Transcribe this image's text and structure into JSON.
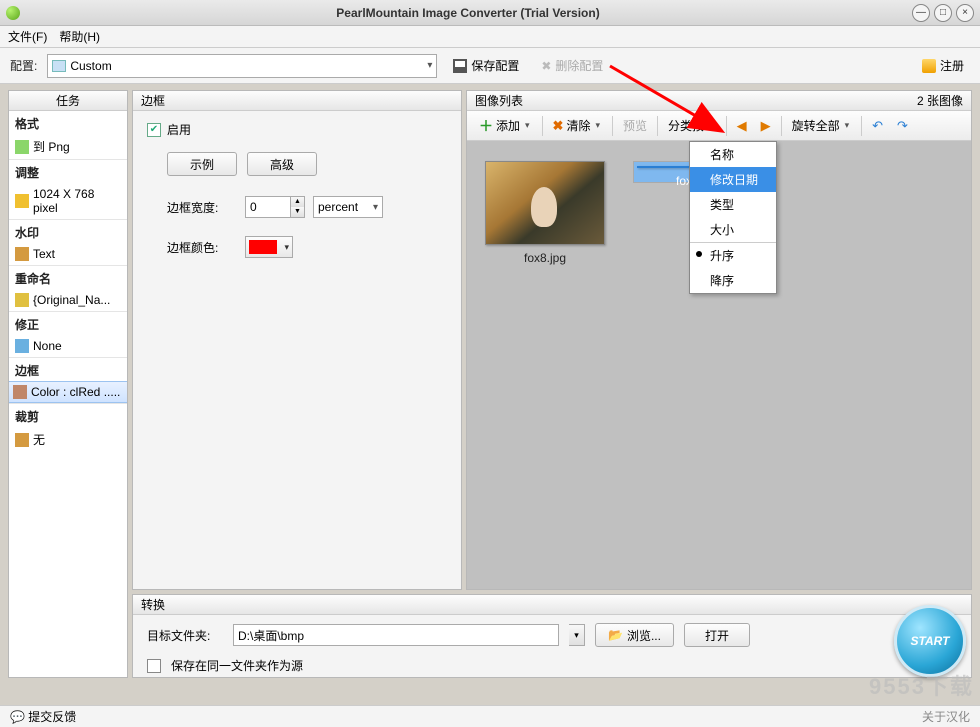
{
  "title": "PearlMountain Image Converter (Trial Version)",
  "menu": {
    "file": "文件(F)",
    "help": "帮助(H)"
  },
  "config": {
    "label": "配置:",
    "selected": "Custom",
    "save": "保存配置",
    "delete": "删除配置",
    "register": "注册"
  },
  "tasks": {
    "header": "任务",
    "groups": [
      {
        "label": "格式",
        "item": "到 Png"
      },
      {
        "label": "调整",
        "item": "1024 X 768 pixel"
      },
      {
        "label": "水印",
        "item": "Text"
      },
      {
        "label": "重命名",
        "item": "{Original_Na..."
      },
      {
        "label": "修正",
        "item": "None"
      },
      {
        "label": "边框",
        "item": "Color : clRed ....."
      },
      {
        "label": "裁剪",
        "item": "无"
      }
    ]
  },
  "border": {
    "title": "边框",
    "enable": "启用",
    "example": "示例",
    "advanced": "高级",
    "width_label": "边框宽度:",
    "width_value": "0",
    "width_unit": "percent",
    "color_label": "边框颜色:",
    "color_hex": "#ff0000"
  },
  "imagelist": {
    "title": "图像列表",
    "count": "2 张图像",
    "toolbar": {
      "add": "添加",
      "clear": "清除",
      "preview": "预览",
      "sort": "分类按",
      "rotate_all": "旋转全部"
    },
    "sort_menu": {
      "name": "名称",
      "modified": "修改日期",
      "type": "类型",
      "size": "大小",
      "asc": "升序",
      "desc": "降序"
    },
    "thumbs": [
      {
        "caption": "fox8.jpg",
        "selected": false
      },
      {
        "caption": "fox4.jpg",
        "selected": true
      }
    ]
  },
  "convert": {
    "title": "转换",
    "dest_label": "目标文件夹:",
    "dest_value": "D:\\桌面\\bmp",
    "browse": "浏览...",
    "open": "打开",
    "same_folder": "保存在同一文件夹作为源"
  },
  "start_label": "START",
  "status": {
    "feedback": "提交反馈",
    "about": "关于汉化"
  },
  "watermark": "9553下载"
}
